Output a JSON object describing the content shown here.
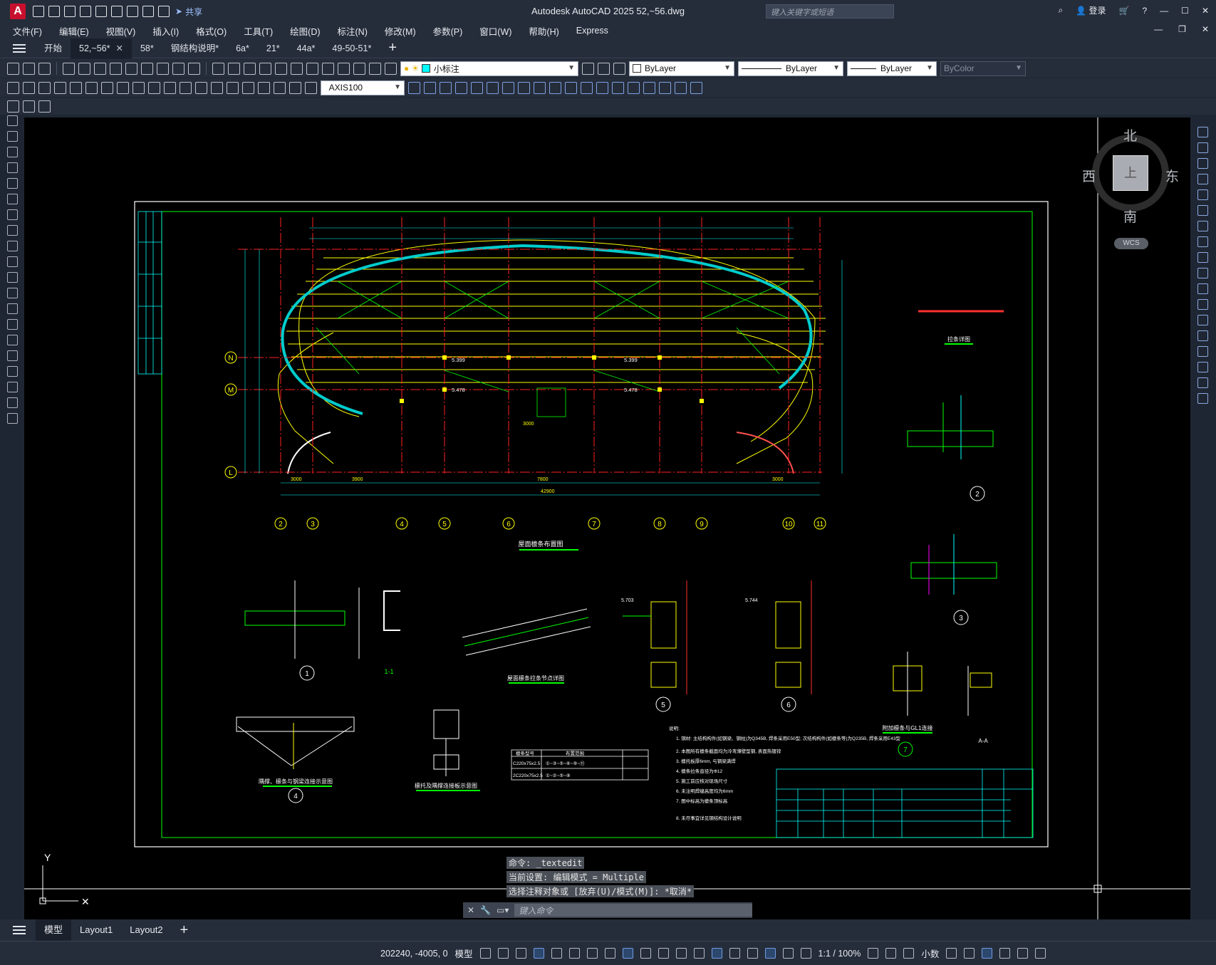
{
  "app": {
    "title": "Autodesk AutoCAD 2025    52,~56.dwg",
    "share_label": "共享",
    "search_placeholder": "键入关键字或短语",
    "signin_label": "登录"
  },
  "menu": [
    "文件(F)",
    "编辑(E)",
    "视图(V)",
    "插入(I)",
    "格式(O)",
    "工具(T)",
    "绘图(D)",
    "标注(N)",
    "修改(M)",
    "参数(P)",
    "窗口(W)",
    "帮助(H)",
    "Express"
  ],
  "tabs": [
    {
      "label": "开始"
    },
    {
      "label": "52,~56*"
    },
    {
      "label": "58*"
    },
    {
      "label": "钢结构说明*"
    },
    {
      "label": "6a*"
    },
    {
      "label": "21*"
    },
    {
      "label": "44a*"
    },
    {
      "label": "49-50-51*"
    }
  ],
  "layer_toolbar": {
    "layer_name": "小标注",
    "color": "ByLayer",
    "linetype": "ByLayer",
    "lineweight": "ByLayer",
    "plotstyle": "ByColor"
  },
  "dim_toolbar": {
    "dimstyle": "AXIS100"
  },
  "viewcube": {
    "north": "北",
    "south": "南",
    "east": "东",
    "west": "西",
    "face": "上",
    "wcs": "WCS"
  },
  "drawing": {
    "axis_labels_bottom": [
      "2",
      "3",
      "4",
      "5",
      "6",
      "7",
      "8",
      "9",
      "10",
      "11"
    ],
    "axis_labels_left": [
      "N",
      "M",
      "L"
    ],
    "main_title": "屋面檩条布置图",
    "detail_title_1": "屋面檩条拉条节点详图",
    "detail_title_2": "隅撑、檩条与钢梁连接示意图",
    "detail_title_3": "檩托及隅撑连接板示意图",
    "detail_title_4": "拉条详图",
    "detail_title_5": "附加檩条与GL1连接",
    "section_label": "1-1",
    "section_aa": "A-A",
    "callouts": [
      "1",
      "2",
      "3",
      "4",
      "5",
      "6",
      "7"
    ],
    "notes_title": "说明:",
    "notes": [
      "1. 钢材: 主结构构件(如钢梁、钢柱)为Q345B, 焊条采用E50型; 次结构构件(如檩条等)为Q235B, 焊条采用E43型",
      "2. 本图所有檩条截面均为冷弯薄壁型钢, 表面热镀锌",
      "3. 檩托板厚6mm, 与钢梁满焊",
      "4. 檩条拉条直径为Φ12",
      "5. 施工前应核对现场尺寸",
      "6. 未注明焊缝高度均为6mm",
      "7. 图中标高为檩条顶标高",
      "8. 未尽事宜详见钢结构设计说明"
    ],
    "purlin_table": {
      "headers": [
        "檩条型号",
        "布置范围"
      ],
      "rows": [
        [
          "C220x75x2.5",
          "①~③~⑤~⑥~⑨~⑪"
        ],
        [
          "2C220x75x2.5",
          "①~②~⑤~⑧"
        ]
      ]
    },
    "levels": [
      "5.399",
      "5.478",
      "5.703",
      "5.744"
    ],
    "dimensions": [
      "3000",
      "3900",
      "7800",
      "42900"
    ]
  },
  "command": {
    "history": [
      "命令: _textedit",
      "当前设置: 编辑模式 = Multiple",
      "选择注释对象或 [放弃(U)/模式(M)]: *取消*"
    ],
    "placeholder": "键入命令"
  },
  "layout_tabs": [
    "模型",
    "Layout1",
    "Layout2"
  ],
  "status": {
    "coords": "202240, -4005, 0",
    "model_label": "模型",
    "scale": "1:1 / 100%",
    "units": "小数"
  }
}
